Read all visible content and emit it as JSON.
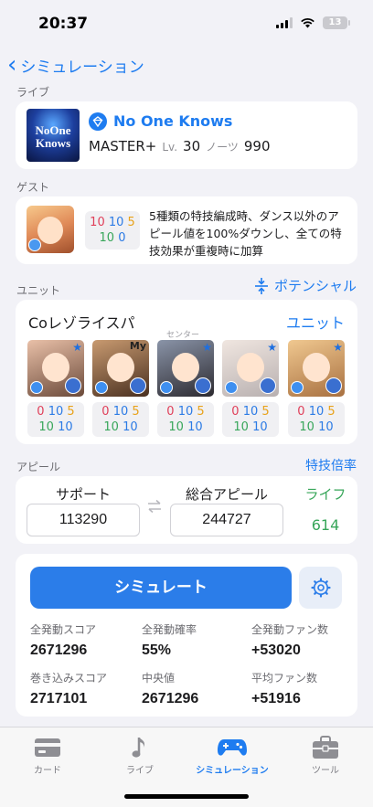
{
  "status_bar": {
    "time": "20:37",
    "battery": "13"
  },
  "nav": {
    "back_label": "シミュレーション"
  },
  "live": {
    "section_title": "ライブ",
    "jacket_text_1": "NoOne",
    "jacket_text_2": "Knows",
    "song_title": "No One Knows",
    "difficulty": "MASTER+",
    "level_label": "Lv.",
    "level": "30",
    "notes_label": "ノーツ",
    "notes": "990"
  },
  "guest": {
    "section_title": "ゲスト",
    "potential": {
      "vo": "10",
      "da": "10",
      "vi": "5",
      "life": "10",
      "skill": "0"
    },
    "description": "5種類の特技編成時、ダンス以外のアピール値を100%ダウンし、全ての特技効果が重複時に加算"
  },
  "unit": {
    "section_title": "ユニット",
    "potential_link": "ポテンシャル",
    "name": "Coレゾライスパ",
    "unit_link": "ユニット",
    "center_label": "センター",
    "my_badge": "My",
    "idols": [
      {
        "vo": "0",
        "da": "10",
        "vi": "5",
        "life": "10",
        "skill": "10",
        "colors": [
          "#e9c0a8",
          "#6b4a3a"
        ]
      },
      {
        "vo": "0",
        "da": "10",
        "vi": "5",
        "life": "10",
        "skill": "10",
        "colors": [
          "#c89a70",
          "#4a3020"
        ]
      },
      {
        "vo": "0",
        "da": "10",
        "vi": "5",
        "life": "10",
        "skill": "10",
        "colors": [
          "#8a94a8",
          "#2c2a30"
        ]
      },
      {
        "vo": "0",
        "da": "10",
        "vi": "5",
        "life": "10",
        "skill": "10",
        "colors": [
          "#f0e6e0",
          "#b8b0b0"
        ]
      },
      {
        "vo": "0",
        "da": "10",
        "vi": "5",
        "life": "10",
        "skill": "10",
        "colors": [
          "#f0c890",
          "#a87040"
        ]
      }
    ]
  },
  "appeal": {
    "section_title": "アピール",
    "multiplier_link": "特技倍率",
    "support_label": "サポート",
    "support_value": "113290",
    "total_label": "総合アピール",
    "total_value": "244727",
    "life_label": "ライフ",
    "life_value": "614"
  },
  "simulate": {
    "button_label": "シミュレート",
    "stats": [
      {
        "label": "全発動スコア",
        "value": "2671296"
      },
      {
        "label": "全発動確率",
        "value": "55%"
      },
      {
        "label": "全発動ファン数",
        "value": "+53020"
      },
      {
        "label": "巻き込みスコア",
        "value": "2717101"
      },
      {
        "label": "中央値",
        "value": "2671296"
      },
      {
        "label": "平均ファン数",
        "value": "+51916"
      }
    ]
  },
  "tabs": [
    {
      "label": "カード",
      "icon": "card-icon",
      "active": false
    },
    {
      "label": "ライブ",
      "icon": "music-note-icon",
      "active": false
    },
    {
      "label": "シミュレーション",
      "icon": "gamepad-icon",
      "active": true
    },
    {
      "label": "ツール",
      "icon": "toolbox-icon",
      "active": false
    }
  ],
  "colors": {
    "accent": "#1e7cf0",
    "life_green": "#38a65a",
    "vo_red": "#e0405a",
    "da_blue": "#2c7be5",
    "vi_orange": "#e8a21a"
  }
}
